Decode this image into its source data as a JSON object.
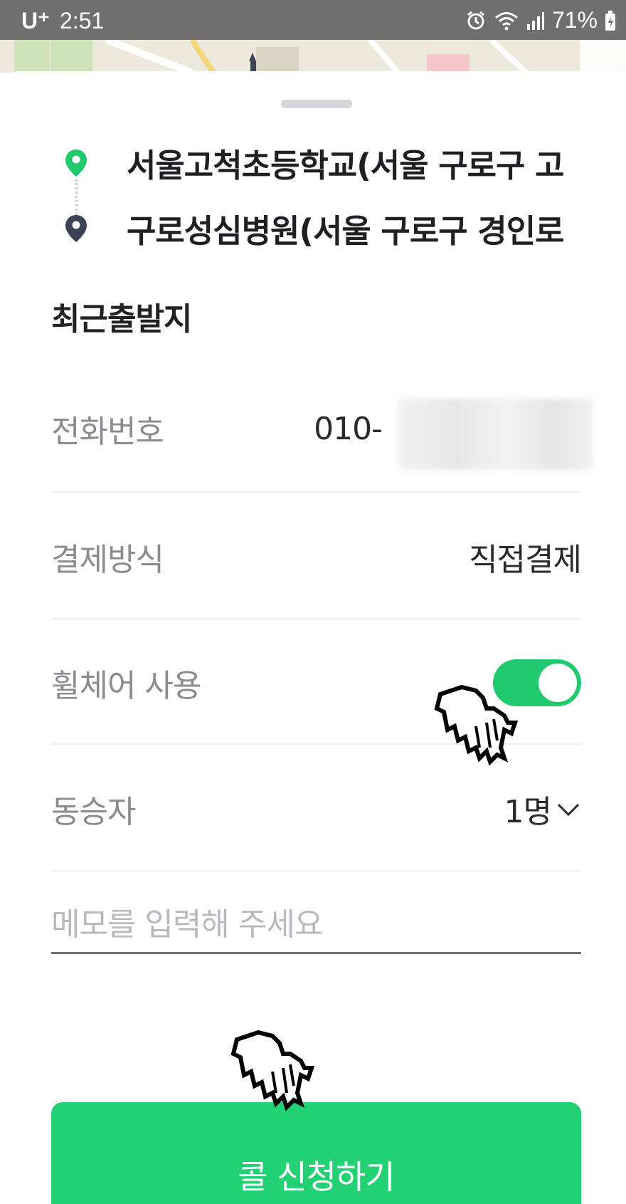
{
  "status_bar": {
    "carrier": "U⁺",
    "time": "2:51",
    "battery": "71%",
    "icons": [
      "alarm-icon",
      "wifi-icon",
      "signal-icon",
      "battery-icon"
    ]
  },
  "route": {
    "origin": "서울고척초등학교(서울 구로구 고",
    "destination": "구로성심병원(서울 구로구 경인로"
  },
  "recent_title": "최근출발지",
  "form": {
    "phone": {
      "label": "전화번호",
      "value": "010-"
    },
    "payment": {
      "label": "결제방식",
      "value": "직접결제"
    },
    "wheelchair": {
      "label": "휠체어 사용",
      "enabled": true
    },
    "companion": {
      "label": "동승자",
      "value": "1명"
    }
  },
  "memo": {
    "placeholder": "메모를 입력해 주세요"
  },
  "call_button": {
    "label": "콜 신청하기"
  },
  "colors": {
    "accent": "#21d174",
    "origin_pin": "#21c96d",
    "destination_pin": "#3d4256",
    "status_bar": "#6f6f6f"
  }
}
